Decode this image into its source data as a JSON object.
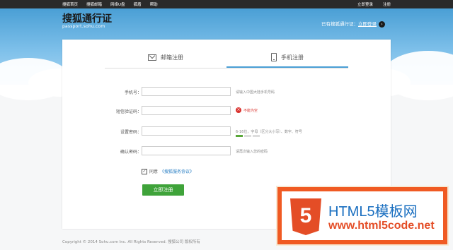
{
  "topbar": {
    "nav": [
      "搜狐首页",
      "搜狐邮箱",
      "网络U盘",
      "狐盾",
      "帮助"
    ],
    "login": "立即登录",
    "register": "注册"
  },
  "header": {
    "logo_text": "搜狐通行证",
    "logo_sub": "passport.sohu.com",
    "have_account": "已有搜狐通行证：",
    "login_link": "立即登录",
    "arrow_icon": "chevron-right-icon"
  },
  "tabs": [
    {
      "label": "邮箱注册",
      "icon": "mail-icon",
      "active": false
    },
    {
      "label": "手机注册",
      "icon": "phone-icon",
      "active": true
    }
  ],
  "form": {
    "phone": {
      "label": "手机号：",
      "value": "",
      "hint": "请输入中国大陆手机号码"
    },
    "code": {
      "label": "短信验证码：",
      "value": "",
      "error": "不能为空"
    },
    "password": {
      "label": "设置密码：",
      "value": "",
      "hint": "6-16位，字母（区分大小写）、数字、符号"
    },
    "confirm": {
      "label": "确认密码：",
      "value": "",
      "hint": "请再次输入您的密码"
    },
    "agree_label": "同意",
    "agree_link": "《搜狐服务协议》",
    "agree_checked": true,
    "submit": "立即注册"
  },
  "footer": "Copyright © 2014 Sohu.com Inc. All Rights Reserved. 搜狐公司 版权所有",
  "watermark": {
    "logo_glyph": "5",
    "title": "HTML5模板网",
    "url": "www.html5code.net"
  },
  "colors": {
    "accent": "#4a9fd5",
    "button": "#3fa33a",
    "error": "#d9302c"
  }
}
